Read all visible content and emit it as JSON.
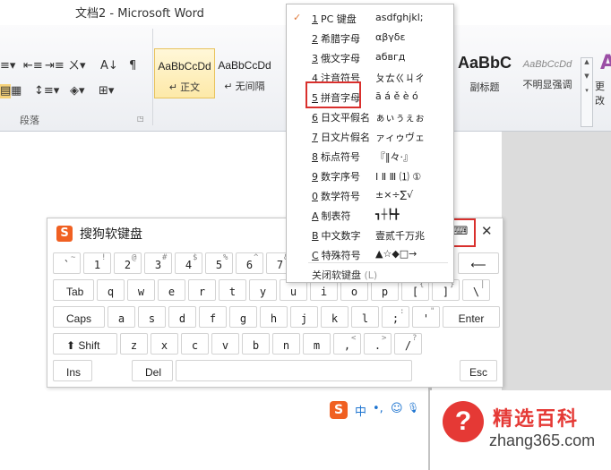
{
  "window": {
    "title": "文档2 - Microsoft Word"
  },
  "ribbon": {
    "paragraph_group_label": "段落",
    "styles": [
      {
        "sample": "AaBbCcDd",
        "name": "↵ 正文",
        "active": true
      },
      {
        "sample": "AaBbCcDd",
        "name": "↵ 无间隔",
        "active": false
      },
      {
        "sample": "AaBbC",
        "name": "副标题",
        "active": false
      },
      {
        "sample": "AaBbCcDd",
        "name": "不明显强调",
        "active": false
      }
    ],
    "change_styles_label": "更改"
  },
  "soft_keyboard": {
    "title": "搜狗软键盘",
    "logo_letter": "S",
    "switch_icon": "⌨",
    "close_icon": "✕",
    "rows": [
      [
        {
          "m": "`",
          "s": "~"
        },
        {
          "m": "1",
          "s": "!"
        },
        {
          "m": "2",
          "s": "@"
        },
        {
          "m": "3",
          "s": "#"
        },
        {
          "m": "4",
          "s": "$"
        },
        {
          "m": "5",
          "s": "%"
        },
        {
          "m": "6",
          "s": "^"
        },
        {
          "m": "7",
          "s": "&"
        }
      ],
      [
        {
          "m": "Tab"
        },
        {
          "m": "q"
        },
        {
          "m": "w"
        },
        {
          "m": "e"
        },
        {
          "m": "r"
        },
        {
          "m": "t"
        },
        {
          "m": "y"
        },
        {
          "m": "u"
        },
        {
          "m": "i"
        },
        {
          "m": "o"
        },
        {
          "m": "p"
        },
        {
          "m": "[",
          "s": "{"
        },
        {
          "m": "]",
          "s": "}"
        },
        {
          "m": "\\",
          "s": "|"
        }
      ],
      [
        {
          "m": "Caps"
        },
        {
          "m": "a"
        },
        {
          "m": "s"
        },
        {
          "m": "d"
        },
        {
          "m": "f"
        },
        {
          "m": "g"
        },
        {
          "m": "h"
        },
        {
          "m": "j"
        },
        {
          "m": "k"
        },
        {
          "m": "l"
        },
        {
          "m": ";",
          "s": ":"
        },
        {
          "m": "'",
          "s": "\""
        },
        {
          "m": "Enter"
        }
      ],
      [
        {
          "m": "⬆ Shift"
        },
        {
          "m": "z"
        },
        {
          "m": "x"
        },
        {
          "m": "c"
        },
        {
          "m": "v"
        },
        {
          "m": "b"
        },
        {
          "m": "n"
        },
        {
          "m": "m"
        },
        {
          "m": ",",
          "s": "<"
        },
        {
          "m": ".",
          "s": ">"
        },
        {
          "m": "/",
          "s": "?"
        }
      ],
      [
        {
          "m": "Ins"
        },
        {
          "m": "Del"
        },
        {
          "m": ""
        },
        {
          "m": "Esc"
        }
      ]
    ],
    "backspace": "⟵"
  },
  "menu": {
    "items": [
      {
        "num": "1",
        "label": "PC 键盘",
        "sample": "asdfghjkl;",
        "checked": true
      },
      {
        "num": "2",
        "label": "希腊字母",
        "sample": "αβγδε",
        "checked": false
      },
      {
        "num": "3",
        "label": "俄文字母",
        "sample": "абвгд",
        "checked": false
      },
      {
        "num": "4",
        "label": "注音符号",
        "sample": "ㄆㄊㄍㄐㄔ",
        "checked": false
      },
      {
        "num": "5",
        "label": "拼音字母",
        "sample": "ā á ě è ó",
        "checked": false,
        "highlighted": true
      },
      {
        "num": "6",
        "label": "日文平假名",
        "sample": "ぁぃぅぇぉ",
        "checked": false
      },
      {
        "num": "7",
        "label": "日文片假名",
        "sample": "ァィゥヴェ",
        "checked": false
      },
      {
        "num": "8",
        "label": "标点符号",
        "sample": "『‖々·』",
        "checked": false
      },
      {
        "num": "9",
        "label": "数字序号",
        "sample": "Ⅰ Ⅱ Ⅲ ⑴ ①",
        "checked": false
      },
      {
        "num": "0",
        "label": "数学符号",
        "sample": "±×÷∑√",
        "checked": false
      },
      {
        "num": "A",
        "label": "制表符",
        "sample": "┓┼┡╋",
        "checked": false
      },
      {
        "num": "B",
        "label": "中文数字",
        "sample": "壹贰千万兆",
        "checked": false
      },
      {
        "num": "C",
        "label": "特殊符号",
        "sample": "▲☆◆□→",
        "checked": false
      }
    ],
    "close_label": "关闭软键盘",
    "close_hint": "(L)"
  },
  "status_ime": {
    "logo_letter": "S",
    "lang": "中",
    "punct": "•,",
    "emoji_icon": "☺",
    "mic_icon": "🎙"
  },
  "watermark": {
    "symbol": "?",
    "name": "精选百科",
    "url": "zhang365.com"
  }
}
